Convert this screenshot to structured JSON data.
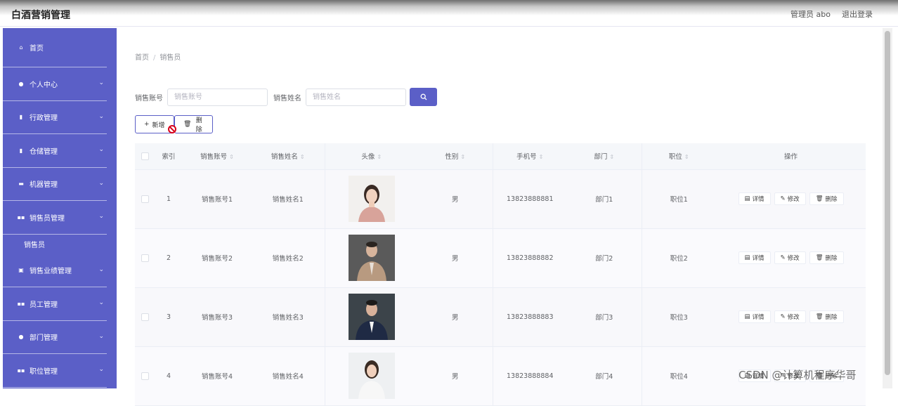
{
  "app": {
    "title": "白酒营销管理"
  },
  "header": {
    "user_label": "管理员 abo",
    "logout_label": "退出登录"
  },
  "sidebar": {
    "items": [
      {
        "label": "首页",
        "icon": "home-icon",
        "glyph": "⌂",
        "chevron": false
      },
      {
        "label": "个人中心",
        "icon": "user-icon",
        "glyph": "●",
        "chevron": true
      },
      {
        "label": "行政管理",
        "icon": "doc-icon",
        "glyph": "▮",
        "chevron": true
      },
      {
        "label": "仓储管理",
        "icon": "doc-icon",
        "glyph": "▮",
        "chevron": true
      },
      {
        "label": "机器管理",
        "icon": "card-icon",
        "glyph": "▬",
        "chevron": true
      },
      {
        "label": "销售员管理",
        "icon": "grid-icon",
        "glyph": "▪▪",
        "chevron": true
      }
    ],
    "sub_item": "销售员",
    "items_after": [
      {
        "label": "销售业绩管理",
        "icon": "image-icon",
        "glyph": "▣",
        "chevron": true
      },
      {
        "label": "员工管理",
        "icon": "grid-icon",
        "glyph": "▪▪",
        "chevron": true
      },
      {
        "label": "部门管理",
        "icon": "user-icon",
        "glyph": "●",
        "chevron": true
      },
      {
        "label": "职位管理",
        "icon": "grid-icon",
        "glyph": "▪▪",
        "chevron": true
      }
    ]
  },
  "breadcrumb": {
    "home": "首页",
    "current": "销售员"
  },
  "search": {
    "account_label": "销售账号",
    "account_placeholder": "销售账号",
    "name_label": "销售姓名",
    "name_placeholder": "销售姓名"
  },
  "actions": {
    "add_label": "新增",
    "delete_label": "删除"
  },
  "table": {
    "columns": [
      "索引",
      "销售账号",
      "销售姓名",
      "头像",
      "性别",
      "手机号",
      "部门",
      "职位",
      "操作"
    ],
    "rows": [
      {
        "index": "1",
        "account": "销售账号1",
        "name": "销售姓名1",
        "gender": "男",
        "phone": "13823888881",
        "dept": "部门1",
        "position": "职位1"
      },
      {
        "index": "2",
        "account": "销售账号2",
        "name": "销售姓名2",
        "gender": "男",
        "phone": "13823888882",
        "dept": "部门2",
        "position": "职位2"
      },
      {
        "index": "3",
        "account": "销售账号3",
        "name": "销售姓名3",
        "gender": "男",
        "phone": "13823888883",
        "dept": "部门3",
        "position": "职位3"
      },
      {
        "index": "4",
        "account": "销售账号4",
        "name": "销售姓名4",
        "gender": "男",
        "phone": "13823888884",
        "dept": "部门4",
        "position": "职位4"
      }
    ],
    "op_detail": "详情",
    "op_edit": "修改",
    "op_delete": "删除"
  },
  "watermark": "CSDN @计算机程序华哥",
  "colors": {
    "primary": "#5b5fc7",
    "danger": "#d9001b"
  }
}
